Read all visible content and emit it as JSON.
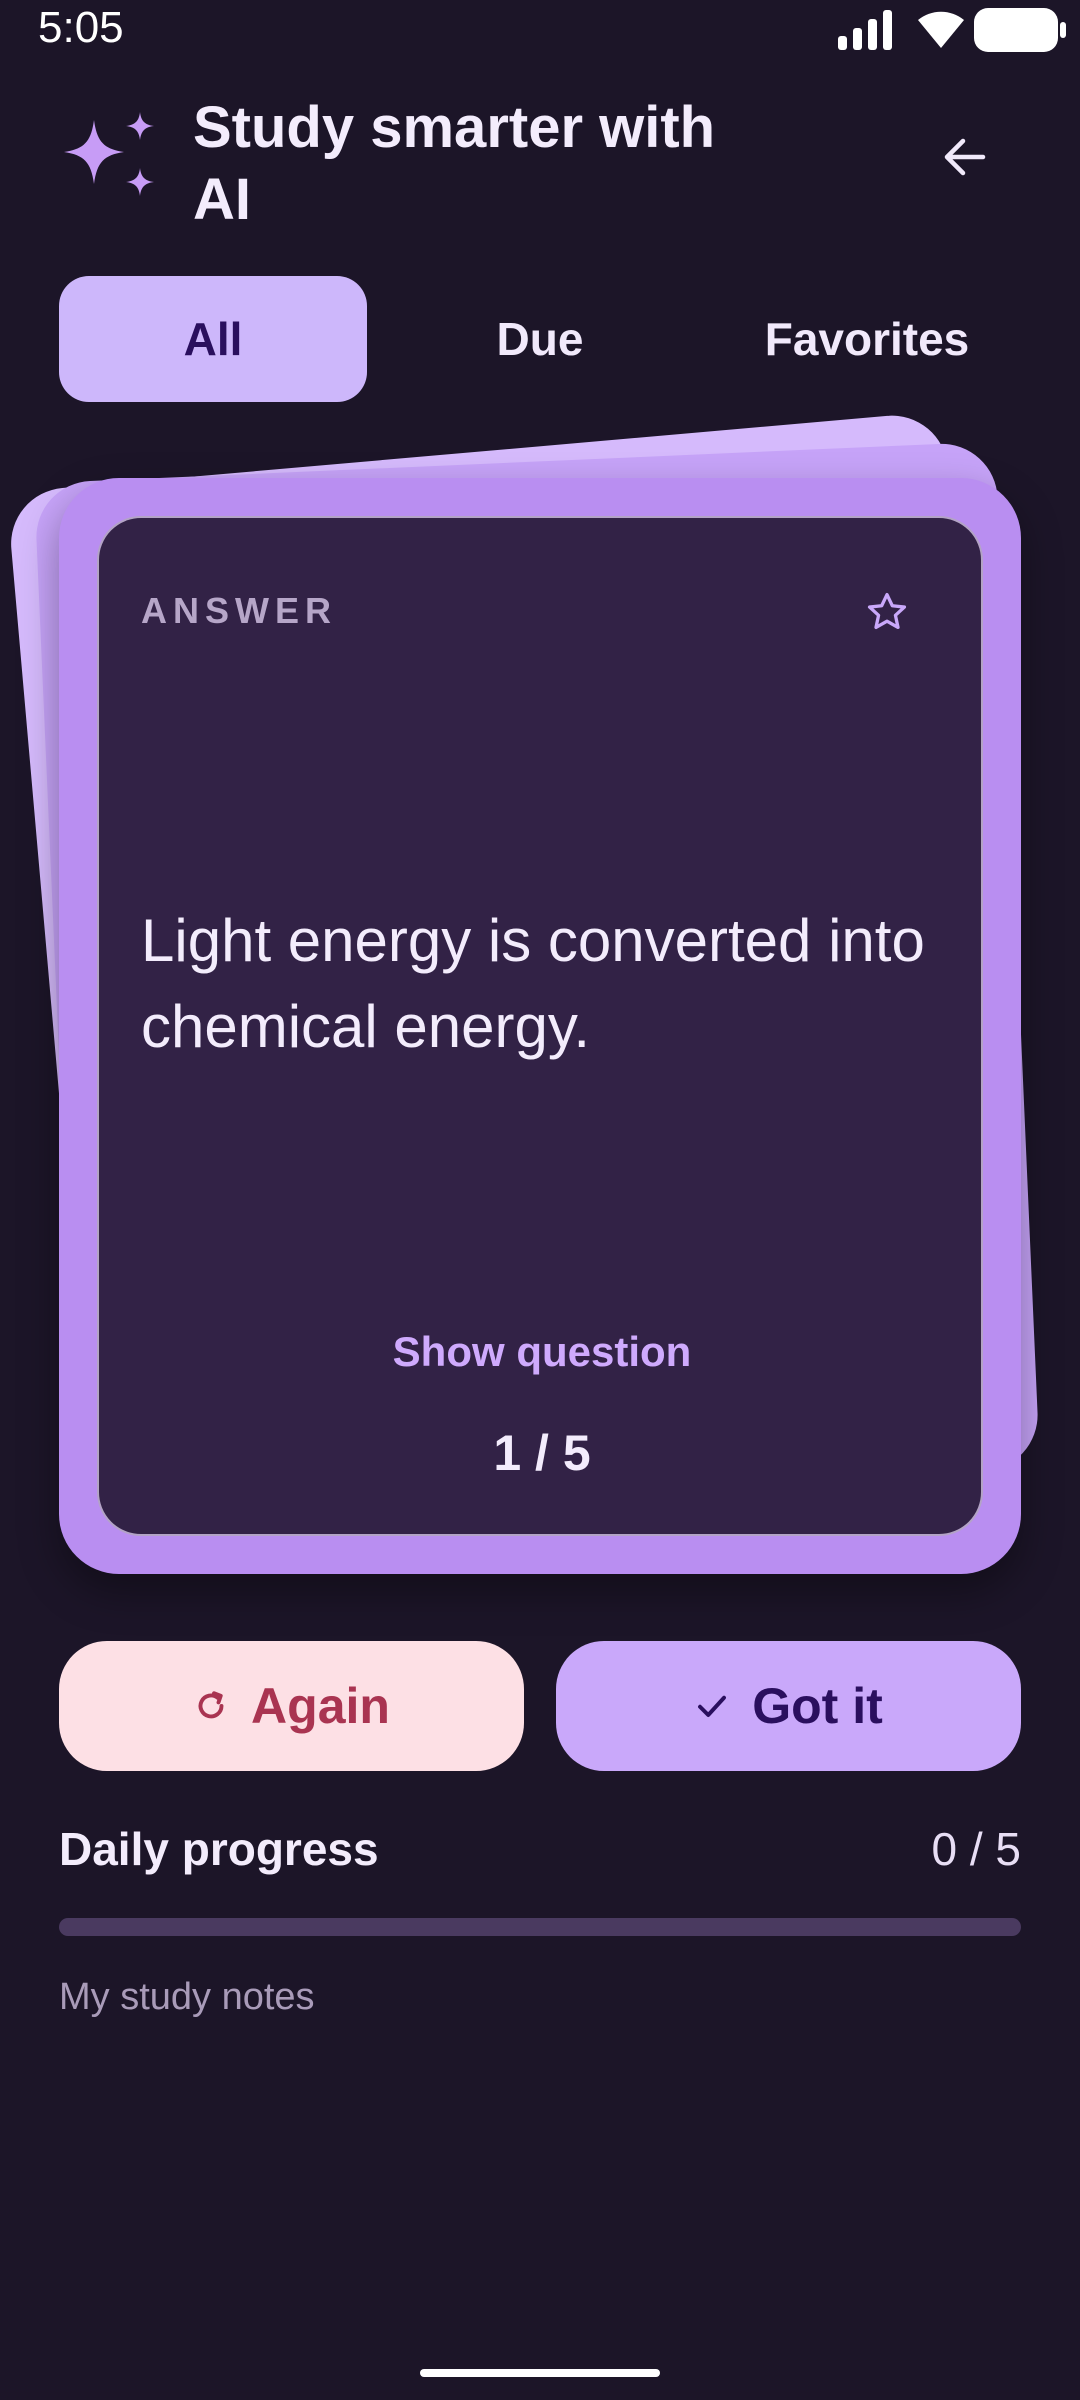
{
  "status_bar": {
    "time": "5:05"
  },
  "header": {
    "title": "Study smarter with AI"
  },
  "tabs": [
    {
      "label": "All",
      "active": true
    },
    {
      "label": "Due",
      "active": false
    },
    {
      "label": "Favorites",
      "active": false
    }
  ],
  "card": {
    "side_label": "ANSWER",
    "text": "Light energy is converted into chemical energy.",
    "flip_label": "Show question",
    "counter": "1 / 5"
  },
  "actions": {
    "again_label": "Again",
    "got_it_label": "Got it"
  },
  "progress": {
    "title": "Daily progress",
    "count": "0 / 5",
    "fraction": 0
  },
  "notes": {
    "label": "My study notes"
  },
  "colors": {
    "background": "#1c1528",
    "accent": "#c9a8fa",
    "card_face": "#322246",
    "again_bg": "#fde0e5",
    "again_text": "#a93451"
  },
  "icons": [
    "sparkle-icon",
    "arrow-left-icon",
    "star-outline-icon",
    "refresh-icon",
    "check-icon"
  ]
}
